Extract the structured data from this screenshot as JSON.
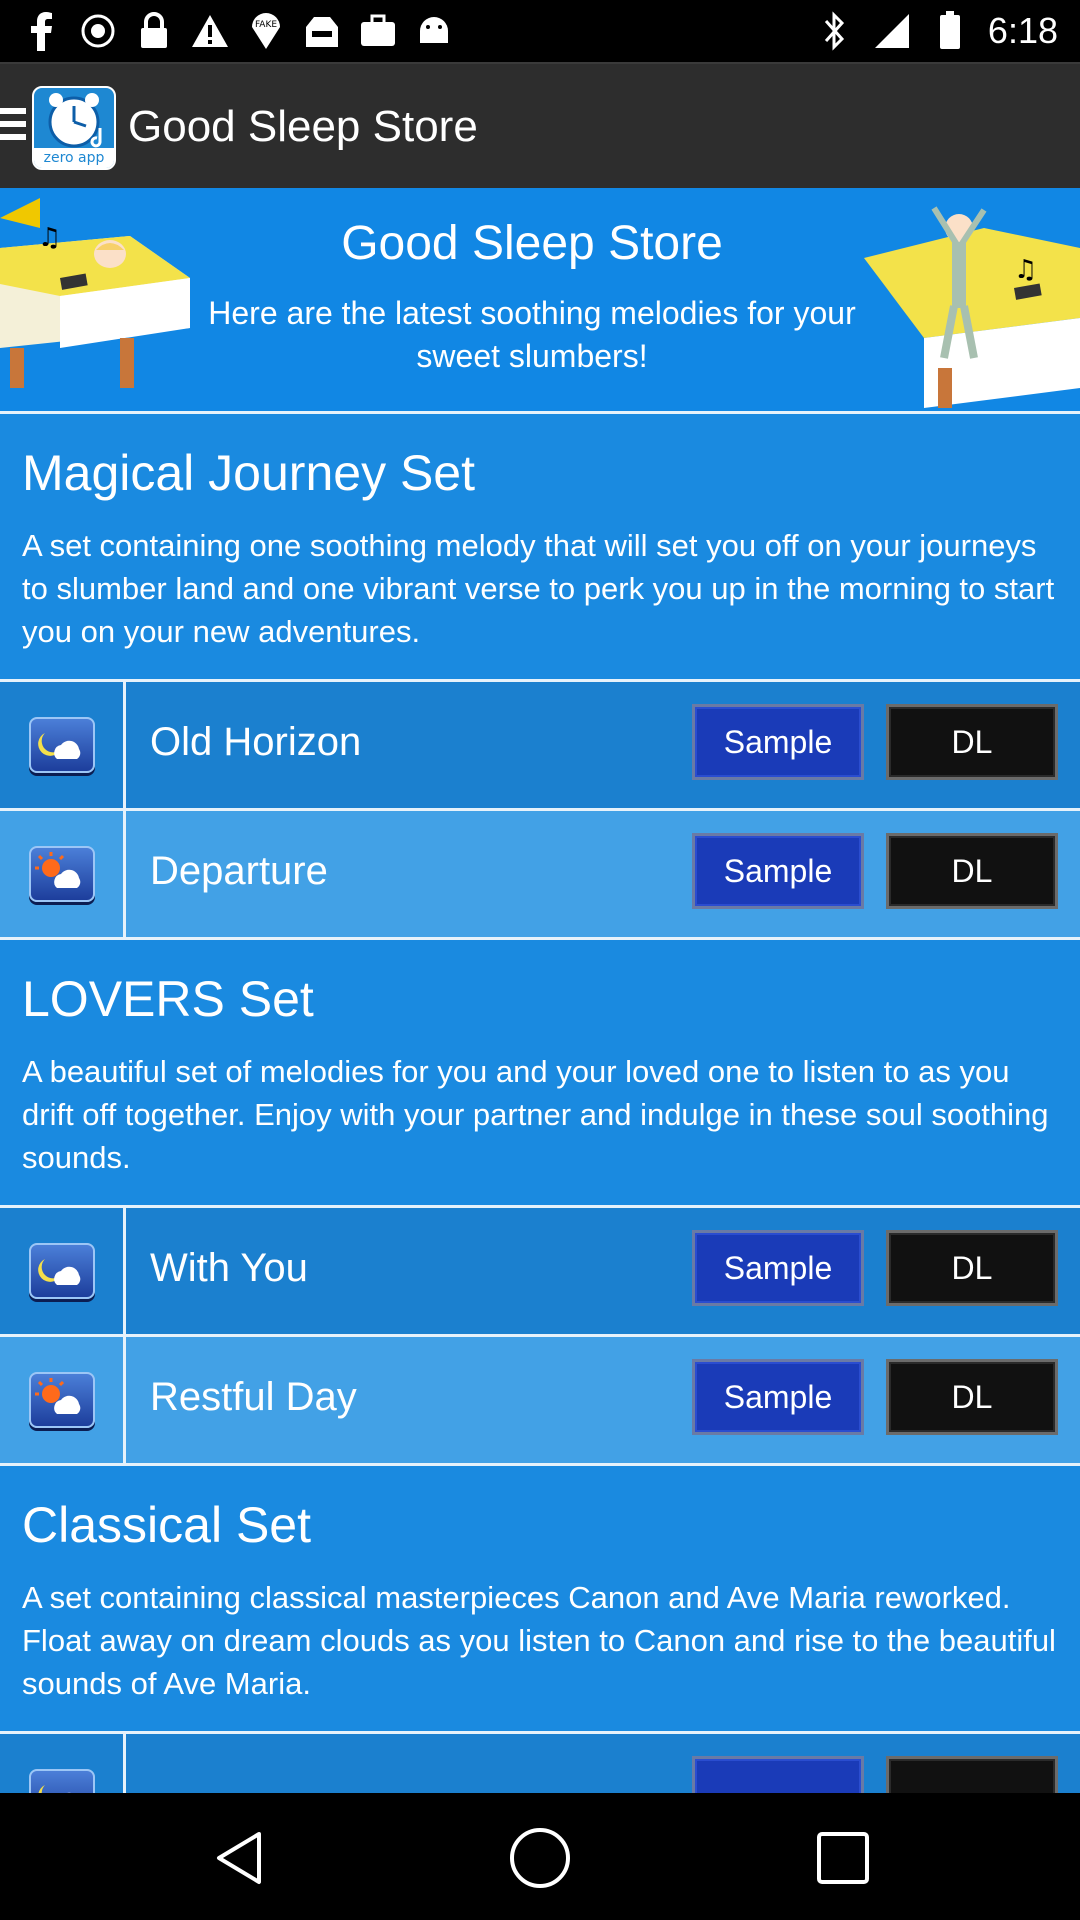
{
  "status_bar": {
    "time": "6:18",
    "left_icons": [
      "facebook-icon",
      "record-icon",
      "lock-icon",
      "warning-icon",
      "fake-gps-icon",
      "inbox-icon",
      "briefcase-icon",
      "android-icon"
    ],
    "right_icons": [
      "bluetooth-icon",
      "signal-icon",
      "battery-icon"
    ]
  },
  "action_bar": {
    "title": "Good Sleep Store",
    "logo_label": "zero app"
  },
  "banner": {
    "title": "Good Sleep Store",
    "subtitle": "Here are the latest soothing melodies for your sweet slumbers!"
  },
  "sets": [
    {
      "title": "Magical Journey Set",
      "description": "A set containing one soothing melody that will set you off on your journeys to slumber land and one vibrant verse to perk you up in the morning to start you on your new adventures.",
      "songs": [
        {
          "name": "Old Horizon",
          "icon": "moon-cloud-icon",
          "sample": "Sample",
          "dl": "DL"
        },
        {
          "name": "Departure",
          "icon": "sun-cloud-icon",
          "sample": "Sample",
          "dl": "DL"
        }
      ]
    },
    {
      "title": "LOVERS Set",
      "description": "A beautiful set of melodies for you and your loved one to listen to as you drift off together. Enjoy with your partner and indulge in these soul soothing sounds.",
      "songs": [
        {
          "name": "With You",
          "icon": "moon-cloud-icon",
          "sample": "Sample",
          "dl": "DL"
        },
        {
          "name": "Restful Day",
          "icon": "sun-cloud-icon",
          "sample": "Sample",
          "dl": "DL"
        }
      ]
    },
    {
      "title": "Classical Set",
      "description": "A set containing classical masterpieces Canon and Ave Maria reworked. Float away on dream clouds as you listen to Canon and rise to the beautiful sounds of Ave Maria.",
      "songs": [
        {
          "name": "",
          "icon": "moon-cloud-icon",
          "sample": "",
          "dl": ""
        }
      ]
    }
  ],
  "nav_bar": {
    "buttons": [
      "back-icon",
      "home-icon",
      "recents-icon"
    ]
  },
  "colors": {
    "content_bg": "#1e8ad6",
    "row_light": "#42a1e6",
    "row_dark": "#1b80cf",
    "sample_btn": "#1a3bb8",
    "dl_btn": "#111111",
    "action_bar": "#2d2d2d"
  }
}
